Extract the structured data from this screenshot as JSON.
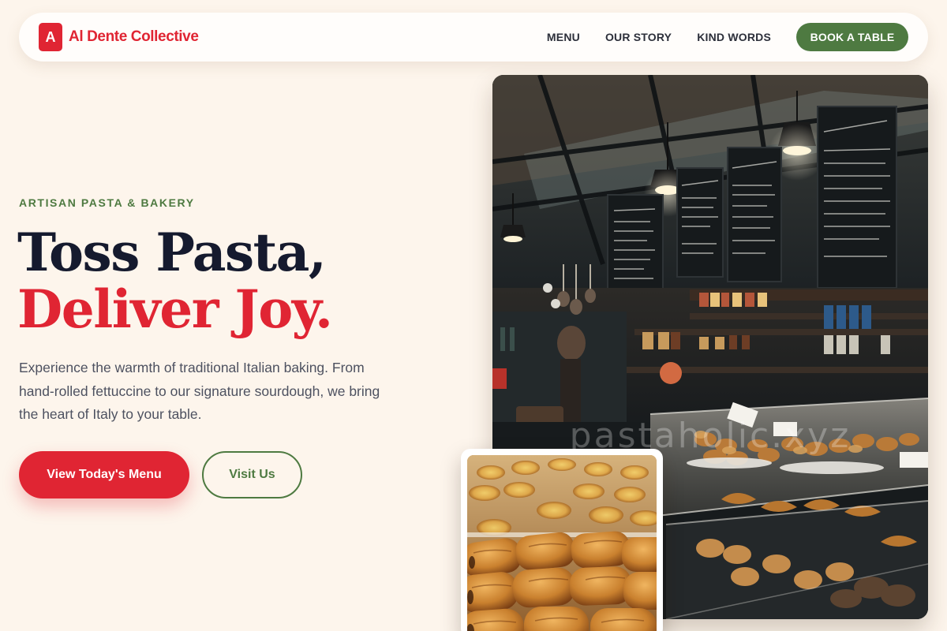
{
  "brand": {
    "logo_letter": "A",
    "name": "Al Dente Collective",
    "accent_color": "#e02533",
    "secondary_color": "#4e7a41"
  },
  "nav": {
    "links": [
      "MENU",
      "OUR STORY",
      "KIND WORDS"
    ],
    "cta_label": "BOOK A TABLE"
  },
  "hero": {
    "eyebrow": "ARTISAN PASTA & BAKERY",
    "headline_line1": "Toss Pasta,",
    "headline_line2": "Deliver Joy.",
    "description": "Experience the warmth of traditional Italian baking. From hand-rolled fettuccine to our signature sourdough, we bring the heart of Italy to your table.",
    "primary_button": "View Today's Menu",
    "secondary_button": "Visit Us"
  },
  "images": {
    "main_watermark": "pastaholic.xyz"
  }
}
